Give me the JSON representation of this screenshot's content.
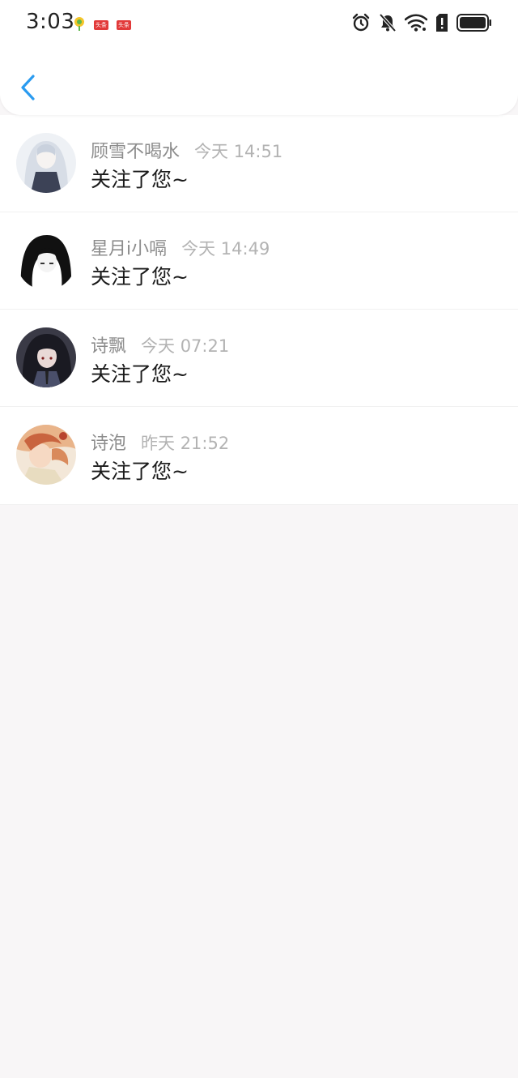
{
  "status_bar": {
    "time": "3:03",
    "badge_1": "头条",
    "badge_2": "头条"
  },
  "nav": {
    "back_icon": "chevron-left-icon",
    "accent_color": "#2a9bf0"
  },
  "notifications": [
    {
      "name": "顾雪不喝水",
      "time": "今天 14:51",
      "message": "关注了您~"
    },
    {
      "name": "星月i小嗝",
      "time": "今天 14:49",
      "message": "关注了您~"
    },
    {
      "name": "诗飘",
      "time": "今天 07:21",
      "message": "关注了您~"
    },
    {
      "name": "诗泡",
      "time": "昨天 21:52",
      "message": "关注了您~"
    }
  ]
}
